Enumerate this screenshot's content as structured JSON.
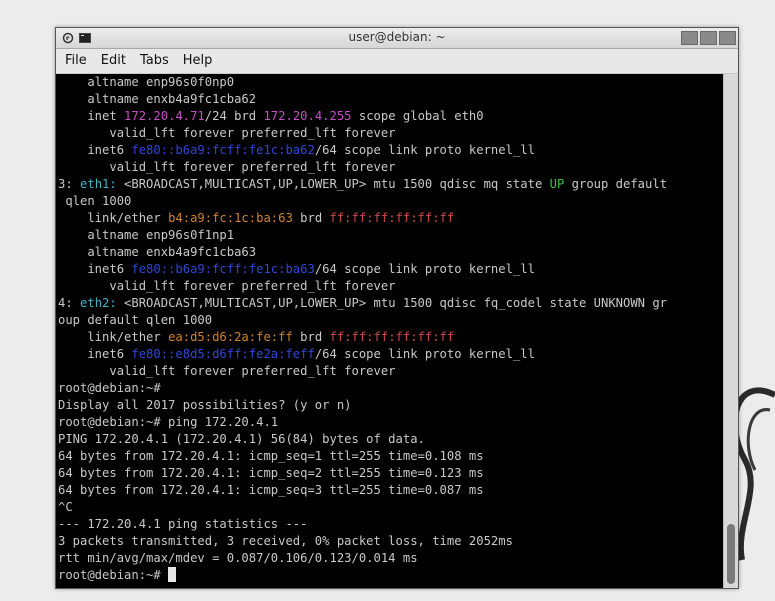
{
  "window": {
    "title": "user@debian: ~"
  },
  "menu": [
    "File",
    "Edit",
    "Tabs",
    "Help"
  ],
  "colors": {
    "terminal_bg": "#000000",
    "text": "#c9c9c9",
    "magenta": "#c34fc3",
    "blue": "#2f47d8",
    "green": "#44c044",
    "cyan": "#3fb5c4",
    "orange": "#d0822c",
    "red": "#d04848"
  },
  "terminal": {
    "lines": [
      [
        {
          "t": "    altname enp96s0f0np0"
        }
      ],
      [
        {
          "t": "    altname enxb4a9fc1cba62"
        }
      ],
      [
        {
          "t": "    inet "
        },
        {
          "t": "172.20.4.71",
          "c": "mg"
        },
        {
          "t": "/24 brd "
        },
        {
          "t": "172.20.4.255",
          "c": "mg"
        },
        {
          "t": " scope global eth0"
        }
      ],
      [
        {
          "t": "       valid_lft forever preferred_lft forever"
        }
      ],
      [
        {
          "t": "    inet6 "
        },
        {
          "t": "fe80::b6a9:fcff:fe1c:ba62",
          "c": "bl"
        },
        {
          "t": "/64 scope link proto kernel_ll"
        }
      ],
      [
        {
          "t": "       valid_lft forever preferred_lft forever"
        }
      ],
      [
        {
          "t": "3: "
        },
        {
          "t": "eth1:",
          "c": "cy"
        },
        {
          "t": " <BROADCAST,MULTICAST,UP,LOWER_UP> mtu 1500 qdisc mq state "
        },
        {
          "t": "UP",
          "c": "gr"
        },
        {
          "t": " group default"
        }
      ],
      [
        {
          "t": " qlen 1000"
        }
      ],
      [
        {
          "t": "    link/ether "
        },
        {
          "t": "b4:a9:fc:1c:ba:63",
          "c": "or"
        },
        {
          "t": " brd "
        },
        {
          "t": "ff:ff:ff:ff:ff:ff",
          "c": "rd"
        }
      ],
      [
        {
          "t": "    altname enp96s0f1np1"
        }
      ],
      [
        {
          "t": "    altname enxb4a9fc1cba63"
        }
      ],
      [
        {
          "t": "    inet6 "
        },
        {
          "t": "fe80::b6a9:fcff:fe1c:ba63",
          "c": "bl"
        },
        {
          "t": "/64 scope link proto kernel_ll"
        }
      ],
      [
        {
          "t": "       valid_lft forever preferred_lft forever"
        }
      ],
      [
        {
          "t": "4: "
        },
        {
          "t": "eth2:",
          "c": "cy"
        },
        {
          "t": " <BROADCAST,MULTICAST,UP,LOWER_UP> mtu 1500 qdisc fq_codel state UNKNOWN gr"
        }
      ],
      [
        {
          "t": "oup default qlen 1000"
        }
      ],
      [
        {
          "t": "    link/ether "
        },
        {
          "t": "ea:d5:d6:2a:fe:ff",
          "c": "or"
        },
        {
          "t": " brd "
        },
        {
          "t": "ff:ff:ff:ff:ff:ff",
          "c": "rd"
        }
      ],
      [
        {
          "t": "    inet6 "
        },
        {
          "t": "fe80::e8d5:d6ff:fe2a:feff",
          "c": "bl"
        },
        {
          "t": "/64 scope link proto kernel_ll"
        }
      ],
      [
        {
          "t": "       valid_lft forever preferred_lft forever"
        }
      ],
      [
        {
          "t": "root@debian:~#"
        }
      ],
      [
        {
          "t": "Display all 2017 possibilities? (y or n)"
        }
      ],
      [
        {
          "t": "root@debian:~# ping 172.20.4.1"
        }
      ],
      [
        {
          "t": "PING 172.20.4.1 (172.20.4.1) 56(84) bytes of data."
        }
      ],
      [
        {
          "t": "64 bytes from 172.20.4.1: icmp_seq=1 ttl=255 time=0.108 ms"
        }
      ],
      [
        {
          "t": "64 bytes from 172.20.4.1: icmp_seq=2 ttl=255 time=0.123 ms"
        }
      ],
      [
        {
          "t": "64 bytes from 172.20.4.1: icmp_seq=3 ttl=255 time=0.087 ms"
        }
      ],
      [
        {
          "t": "^C"
        }
      ],
      [
        {
          "t": "--- 172.20.4.1 ping statistics ---"
        }
      ],
      [
        {
          "t": "3 packets transmitted, 3 received, 0% packet loss, time 2052ms"
        }
      ],
      [
        {
          "t": "rtt min/avg/max/mdev = 0.087/0.106/0.123/0.014 ms"
        }
      ],
      [
        {
          "t": "root@debian:~# "
        }
      ]
    ]
  }
}
